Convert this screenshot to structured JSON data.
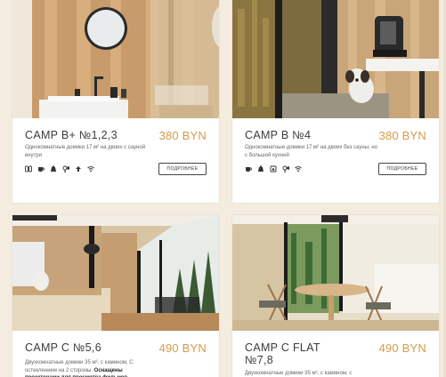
{
  "cards": [
    {
      "title": "CAMP B+ №1,2,3",
      "price": "380 BYN",
      "desc": "Однокомнатные домики 17 м² на двоих с сауной внутри",
      "button": "ПОДРОБНЕЕ",
      "amenities": [
        "sauna-icon",
        "coffee-icon",
        "kettle-icon",
        "hair-dryer-icon",
        "heater-icon",
        "wifi-icon"
      ]
    },
    {
      "title": "CAMP B №4",
      "price": "380 BYN",
      "desc": "Однокомнатные домики 17 м² на двоих без сауны, но с большой кухней",
      "button": "ПОДРОБНЕЕ",
      "amenities": [
        "coffee-icon",
        "kettle-icon",
        "cooker-icon",
        "hair-dryer-icon",
        "wifi-icon"
      ]
    },
    {
      "title": "CAMP C №5,6",
      "price": "490 BYN",
      "desc_plain": "Двухкомнатные домики 35 м², с камином, С остеклением на 2 стороны.",
      "desc_bold": "Оснащены проекторами для просмотра фильмов"
    },
    {
      "title_line1": "CAMP C FLAT",
      "title_line2": "№7,8",
      "price": "490 BYN",
      "desc": "Двухкомнатные домики 35 м², с камином, с"
    }
  ],
  "colors": {
    "accent": "#d59a4a",
    "background": "#f3ecdf"
  }
}
